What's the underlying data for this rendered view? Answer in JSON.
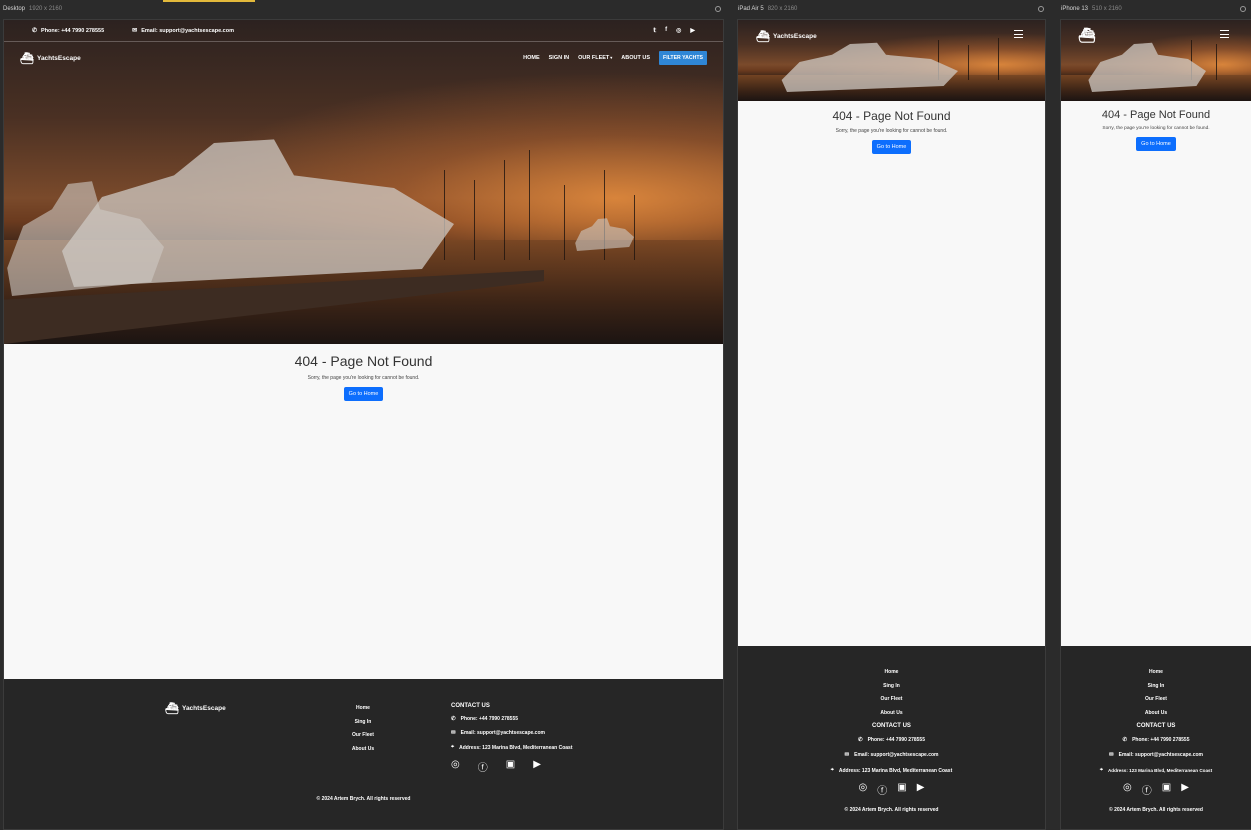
{
  "frames": {
    "desktop": {
      "name": "Desktop",
      "size": "1920 x 2160"
    },
    "ipad": {
      "name": "iPad Air 5",
      "size": "820 x 2160"
    },
    "iphone": {
      "name": "iPhone 13",
      "size": "510 x 2160"
    }
  },
  "brand": "YachtsEscape",
  "topbar": {
    "phone": "Phone: +44 7990 278555",
    "email": "Email: support@yachtsescape.com"
  },
  "nav": {
    "home": "HOME",
    "sign_in": "SIGN IN",
    "fleet": "OUR FLEET",
    "about": "ABOUT US",
    "cta": "FILTER YACHTS"
  },
  "not_found": {
    "title": "404 - Page Not Found",
    "message": "Sorry, the page you're looking for cannot be found.",
    "button": "Go to Home"
  },
  "footer": {
    "links": [
      "Home",
      "Sing In",
      "Our Fleet",
      "About Us"
    ],
    "contact_title": "CONTACT US",
    "phone": "Phone: +44 7990 278555",
    "email": "Email: support@yachtsescape.com",
    "address": "Address: 123 Marina Blvd, Mediterranean Coast",
    "copyright": "© 2024   Artem Brych.   All rights reserved"
  },
  "icons": {
    "twitter": "twitter-icon",
    "facebook": "facebook-icon",
    "instagram": "instagram-icon",
    "youtube": "youtube-icon"
  },
  "colors": {
    "button": "#0d6efd",
    "cta": "#2f86d6",
    "footer": "#262626",
    "page": "#f8f8f8"
  }
}
